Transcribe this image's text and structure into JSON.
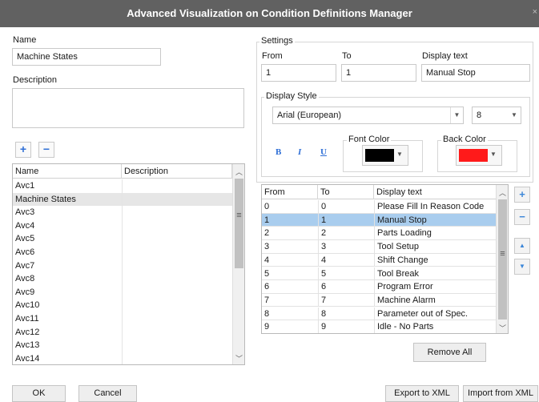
{
  "window": {
    "title": "Advanced Visualization on Condition Definitions Manager",
    "close_glyph": "×"
  },
  "left": {
    "name_label": "Name",
    "name_value": "Machine States",
    "description_label": "Description",
    "description_value": "",
    "add_glyph": "+",
    "remove_glyph": "−",
    "list_headers": {
      "name": "Name",
      "description": "Description"
    },
    "list_rows": [
      {
        "name": "Avc1",
        "description": ""
      },
      {
        "name": "Machine States",
        "description": ""
      },
      {
        "name": "Avc3",
        "description": ""
      },
      {
        "name": "Avc4",
        "description": ""
      },
      {
        "name": "Avc5",
        "description": ""
      },
      {
        "name": "Avc6",
        "description": ""
      },
      {
        "name": "Avc7",
        "description": ""
      },
      {
        "name": "Avc8",
        "description": ""
      },
      {
        "name": "Avc9",
        "description": ""
      },
      {
        "name": "Avc10",
        "description": ""
      },
      {
        "name": "Avc11",
        "description": ""
      },
      {
        "name": "Avc12",
        "description": ""
      },
      {
        "name": "Avc13",
        "description": ""
      },
      {
        "name": "Avc14",
        "description": ""
      }
    ],
    "selected_row": 1
  },
  "settings": {
    "legend": "Settings",
    "from_label": "From",
    "to_label": "To",
    "display_text_label": "Display text",
    "from_value": "1",
    "to_value": "1",
    "display_text_value": "Manual Stop",
    "display_style": {
      "legend": "Display Style",
      "font": "Arial (European)",
      "size": "8",
      "bold_glyph": "B",
      "italic_glyph": "I",
      "underline_glyph": "U",
      "font_color_label": "Font Color",
      "font_color": "#000000",
      "back_color_label": "Back Color",
      "back_color": "#ff1a1a"
    }
  },
  "grid": {
    "headers": {
      "from": "From",
      "to": "To",
      "display_text": "Display text"
    },
    "rows": [
      {
        "from": "0",
        "to": "0",
        "text": "Please Fill In Reason Code"
      },
      {
        "from": "1",
        "to": "1",
        "text": "Manual Stop"
      },
      {
        "from": "2",
        "to": "2",
        "text": "Parts Loading"
      },
      {
        "from": "3",
        "to": "3",
        "text": "Tool Setup"
      },
      {
        "from": "4",
        "to": "4",
        "text": "Shift Change"
      },
      {
        "from": "5",
        "to": "5",
        "text": "Tool Break"
      },
      {
        "from": "6",
        "to": "6",
        "text": "Program Error"
      },
      {
        "from": "7",
        "to": "7",
        "text": "Machine Alarm"
      },
      {
        "from": "8",
        "to": "8",
        "text": "Parameter out of Spec."
      },
      {
        "from": "9",
        "to": "9",
        "text": "Idle - No Parts"
      }
    ],
    "selected_row": 1,
    "selection_color": "#a9cdee",
    "add_glyph": "+",
    "remove_glyph": "−",
    "up_glyph": "▲",
    "down_glyph": "▼",
    "remove_all_label": "Remove All"
  },
  "footer": {
    "ok_label": "OK",
    "cancel_label": "Cancel",
    "export_label": "Export to XML",
    "import_label": "Import from XML"
  }
}
